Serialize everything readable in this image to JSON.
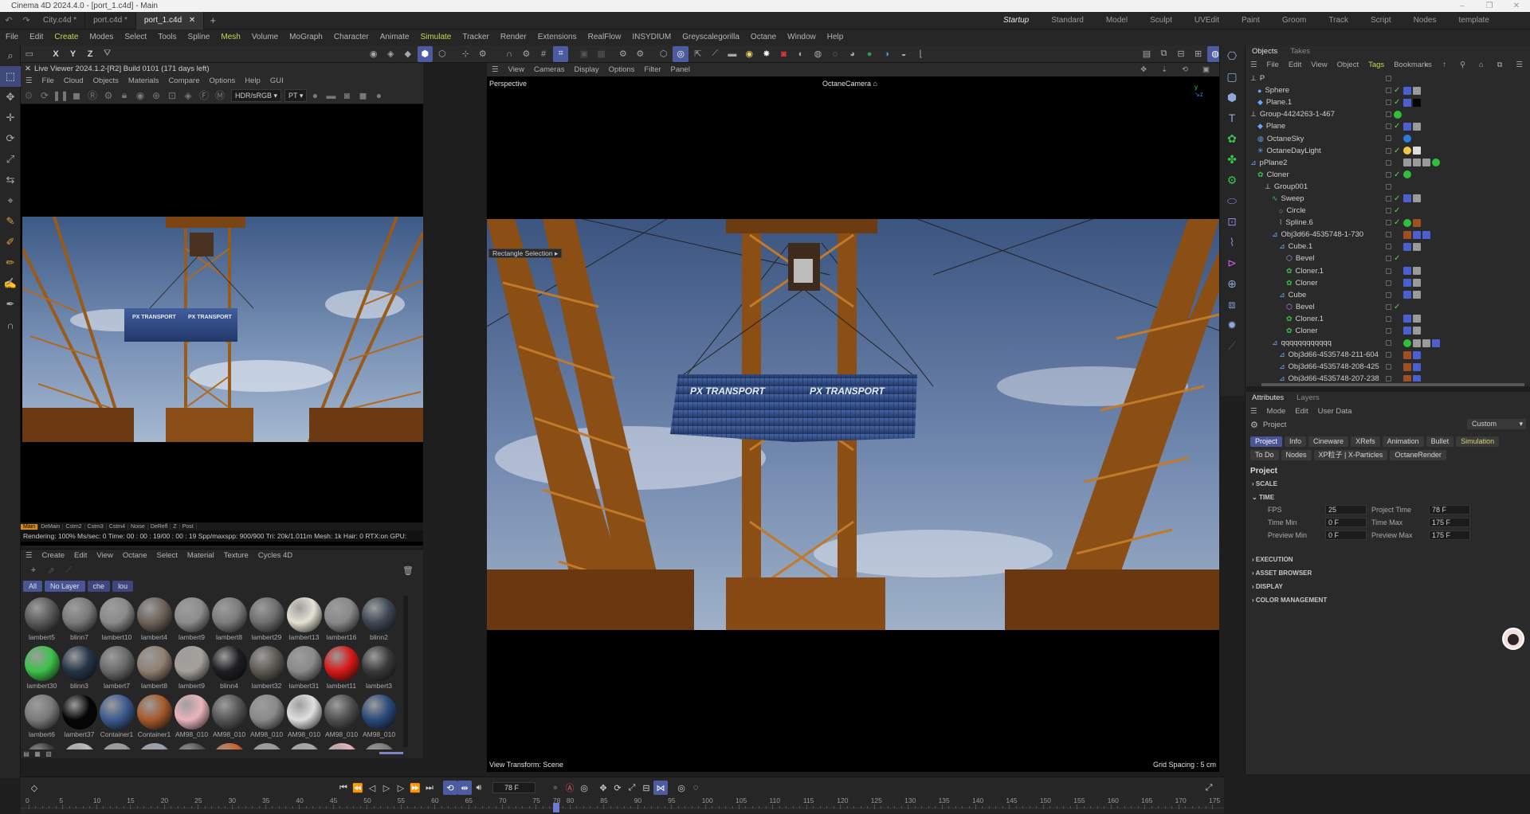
{
  "title": "Cinema 4D 2024.4.0 - [port_1.c4d] - Main",
  "doc_tabs": [
    {
      "label": "City.c4d *"
    },
    {
      "label": "port.c4d *"
    },
    {
      "label": "port_1.c4d"
    }
  ],
  "layouts": [
    {
      "label": "Startup",
      "active": true
    },
    {
      "label": "Standard"
    },
    {
      "label": "Model"
    },
    {
      "label": "Sculpt"
    },
    {
      "label": "UVEdit"
    },
    {
      "label": "Paint"
    },
    {
      "label": "Groom"
    },
    {
      "label": "Track"
    },
    {
      "label": "Script"
    },
    {
      "label": "Nodes"
    },
    {
      "label": "template"
    }
  ],
  "menu": [
    "File",
    "Edit",
    "Create",
    "Modes",
    "Select",
    "Tools",
    "Spline",
    "Mesh",
    "Volume",
    "MoGraph",
    "Character",
    "Animate",
    "Simulate",
    "Tracker",
    "Render",
    "Extensions",
    "RealFlow",
    "INSYDIUM",
    "Greyscalegorilla",
    "Octane",
    "Window",
    "Help"
  ],
  "live_viewer": {
    "title": "Live Viewer 2024.1.2-[R2] Build 0101 (171 days left)",
    "menu": [
      "File",
      "Cloud",
      "Objects",
      "Materials",
      "Compare",
      "Options",
      "Help",
      "GUI"
    ],
    "color_space": "HDR/sRGB",
    "kernel": "PT",
    "passes": [
      "Main",
      "DeMain",
      "Cstm2",
      "Cstm3",
      "Cstm4",
      "Noise",
      "DeRefl",
      "Z",
      "Post"
    ],
    "status": "Rendering: 100%   Ms/sec: 0   Time: 00 : 00 : 19/00 : 00 : 19   Spp/maxspp: 900/900     Tri: 20k/1.011m   Mesh: 1k   Hair: 0   RTX:on     GPU:",
    "container_label_1": "PX TRANSPORT",
    "container_label_2": "PX TRANSPORT"
  },
  "material_manager": {
    "menu": [
      "Create",
      "Edit",
      "View",
      "Octane",
      "Select",
      "Material",
      "Texture",
      "Cycles 4D"
    ],
    "filters": [
      "All",
      "No Layer",
      "che",
      "lou"
    ],
    "materials": [
      {
        "name": "lambert5",
        "color": "#5a5a5a"
      },
      {
        "name": "blinn7",
        "color": "#7a7a7a"
      },
      {
        "name": "lambert10",
        "color": "#8a8a8a"
      },
      {
        "name": "lambert4",
        "color": "#6d6258"
      },
      {
        "name": "lambert9",
        "color": "#8c8c8c"
      },
      {
        "name": "lambert8",
        "color": "#7c7c7c"
      },
      {
        "name": "lambert29",
        "color": "#6e6e6e"
      },
      {
        "name": "lambert13",
        "color": "#e4e1d4"
      },
      {
        "name": "lambert16",
        "color": "#888888"
      },
      {
        "name": "blinn2",
        "color": "#3d4855"
      },
      {
        "name": "lambert30",
        "color": "#3cc24a"
      },
      {
        "name": "blinn3",
        "color": "#243548"
      },
      {
        "name": "lambert7",
        "color": "#6a6a6a"
      },
      {
        "name": "lambert8",
        "color": "#8f8070"
      },
      {
        "name": "lambert9",
        "color": "#a5a09a"
      },
      {
        "name": "blinn4",
        "color": "#1e1e22"
      },
      {
        "name": "lambert32",
        "color": "#5e5a52"
      },
      {
        "name": "lambert31",
        "color": "#8a8a8a"
      },
      {
        "name": "lambert11",
        "color": "#d81818"
      },
      {
        "name": "lambert3",
        "color": "#3a3a3a"
      },
      {
        "name": "lambert6",
        "color": "#7a7a7a"
      },
      {
        "name": "lambert37",
        "color": "#050505"
      },
      {
        "name": "Container1",
        "color": "#3c5a90"
      },
      {
        "name": "Container1",
        "color": "#a55a2c"
      },
      {
        "name": "AM98_010",
        "color": "#e9b5bb"
      },
      {
        "name": "AM98_010",
        "color": "#555555"
      },
      {
        "name": "AM98_010",
        "color": "#8a8a8a"
      },
      {
        "name": "AM98_010",
        "color": "#e0e0e0"
      },
      {
        "name": "AM98_010",
        "color": "#4f4f4f"
      },
      {
        "name": "AM98_010",
        "color": "#294a7a"
      },
      {
        "name": "",
        "color": "#3a3a3a"
      },
      {
        "name": "",
        "color": "#bdbdbd"
      },
      {
        "name": "",
        "color": "#9a9a9a"
      },
      {
        "name": "",
        "color": "#9aa0b0"
      },
      {
        "name": "",
        "color": "#555555"
      },
      {
        "name": "",
        "color": "#d25f2a"
      },
      {
        "name": "",
        "color": "#9a9a9a"
      },
      {
        "name": "",
        "color": "#aaaaaa"
      },
      {
        "name": "",
        "color": "#e9b5bb"
      },
      {
        "name": "",
        "color": "#7a7a7a"
      }
    ]
  },
  "viewport": {
    "menu": [
      "View",
      "Cameras",
      "Display",
      "Options",
      "Filter",
      "Panel"
    ],
    "view_name": "Perspective",
    "camera": "OctaneCamera",
    "tooltip": "Rectangle Selection",
    "view_transform": "View Transform: Scene",
    "grid_spacing": "Grid Spacing : 5 cm",
    "container_label_1": "PX TRANSPORT",
    "container_label_2": "PX TRANSPORT"
  },
  "object_manager": {
    "tabs": [
      "Objects",
      "Takes"
    ],
    "menu": [
      "File",
      "Edit",
      "View",
      "Object",
      "Tags",
      "Bookmarks"
    ],
    "items": [
      {
        "name": "P",
        "depth": 0,
        "icon": "null",
        "tags": []
      },
      {
        "name": "Sphere",
        "depth": 1,
        "icon": "sphere",
        "tags": [
          "check",
          "mat-blue",
          "mat-gray"
        ]
      },
      {
        "name": "Plane.1",
        "depth": 1,
        "icon": "plane",
        "tags": [
          "check",
          "mat-blue",
          "mat-black"
        ]
      },
      {
        "name": "Group-4424263-1-467",
        "depth": 0,
        "icon": "null",
        "tags": [
          "green-dot"
        ]
      },
      {
        "name": "Plane",
        "depth": 1,
        "icon": "plane",
        "tags": [
          "check",
          "mat-blue",
          "mat-gray"
        ]
      },
      {
        "name": "OctaneSky",
        "depth": 1,
        "icon": "sky",
        "tags": [
          "",
          "half-blue"
        ]
      },
      {
        "name": "OctaneDayLight",
        "depth": 1,
        "icon": "light",
        "tags": [
          "check",
          "sun",
          "gear"
        ]
      },
      {
        "name": "pPlane2",
        "depth": 0,
        "icon": "poly",
        "tags": [
          "",
          "mat-gray",
          "mat-gray",
          "mat-gray",
          "green-dot"
        ]
      },
      {
        "name": "Cloner",
        "depth": 1,
        "icon": "cloner",
        "tags": [
          "check",
          "green-dot"
        ]
      },
      {
        "name": "Group001",
        "depth": 2,
        "icon": "null",
        "tags": []
      },
      {
        "name": "Sweep",
        "depth": 3,
        "icon": "sweep",
        "tags": [
          "check",
          "mat-blue",
          "mat-gray"
        ]
      },
      {
        "name": "Circle",
        "depth": 4,
        "icon": "circle",
        "tags": [
          "check"
        ]
      },
      {
        "name": "Spline.6",
        "depth": 4,
        "icon": "spline",
        "tags": [
          "check",
          "green-dot",
          "mat-brown"
        ]
      },
      {
        "name": "Obj3d66-4535748-1-730",
        "depth": 3,
        "icon": "poly",
        "tags": [
          "",
          "mat-brown",
          "mat-blue",
          "mat-blue"
        ]
      },
      {
        "name": "Cube.1",
        "depth": 4,
        "icon": "cube",
        "tags": [
          "",
          "mat-blue",
          "mat-gray"
        ]
      },
      {
        "name": "Bevel",
        "depth": 5,
        "icon": "bevel",
        "tags": [
          "check"
        ]
      },
      {
        "name": "Cloner.1",
        "depth": 5,
        "icon": "cloner",
        "tags": [
          "",
          "mat-blue",
          "mat-gray"
        ]
      },
      {
        "name": "Cloner",
        "depth": 5,
        "icon": "cloner",
        "tags": [
          "",
          "mat-blue",
          "mat-gray"
        ]
      },
      {
        "name": "Cube",
        "depth": 4,
        "icon": "cube",
        "tags": [
          "",
          "mat-blue",
          "mat-gray"
        ]
      },
      {
        "name": "Bevel",
        "depth": 5,
        "icon": "bevel",
        "tags": [
          "check"
        ]
      },
      {
        "name": "Cloner.1",
        "depth": 5,
        "icon": "cloner",
        "tags": [
          "",
          "mat-blue",
          "mat-gray"
        ]
      },
      {
        "name": "Cloner",
        "depth": 5,
        "icon": "cloner",
        "tags": [
          "",
          "mat-blue",
          "mat-gray"
        ]
      },
      {
        "name": "qqqqqqqqqqqq",
        "depth": 3,
        "icon": "poly",
        "tags": [
          "",
          "green-dot",
          "mat-gray",
          "mat-gray",
          "mat-blue"
        ]
      },
      {
        "name": "Obj3d66-4535748-211-604",
        "depth": 4,
        "icon": "poly",
        "tags": [
          "",
          "mat-brown",
          "mat-blue"
        ]
      },
      {
        "name": "Obj3d66-4535748-208-425",
        "depth": 4,
        "icon": "poly",
        "tags": [
          "",
          "mat-brown",
          "mat-blue"
        ]
      },
      {
        "name": "Obj3d66-4535748-207-238",
        "depth": 4,
        "icon": "poly",
        "tags": [
          "",
          "mat-brown",
          "mat-blue"
        ]
      }
    ]
  },
  "attributes": {
    "tabs": [
      "Attributes",
      "Layers"
    ],
    "menu": [
      "Mode",
      "Edit",
      "User Data"
    ],
    "context": "Project",
    "preset": "Custom",
    "page_tabs_row1": [
      "Project",
      "Info",
      "Cineware",
      "XRefs",
      "Animation",
      "Bullet",
      "Simulation"
    ],
    "page_tabs_row2": [
      "To Do",
      "Nodes",
      "XP粒子 | X-Particles",
      "OctaneRender"
    ],
    "heading": "Project",
    "sections": [
      "SCALE",
      "TIME",
      "EXECUTION",
      "ASSET BROWSER",
      "DISPLAY",
      "COLOR MANAGEMENT"
    ],
    "time": {
      "fps_label": "FPS",
      "fps": "25",
      "project_time_label": "Project Time",
      "project_time": "78 F",
      "time_min_label": "Time Min",
      "time_min": "0 F",
      "time_max_label": "Time Max",
      "time_max": "175 F",
      "preview_min_label": "Preview Min",
      "preview_min": "0 F",
      "preview_max_label": "Preview Max",
      "preview_max": "175 F"
    }
  },
  "timeline": {
    "current_frame": "78 F",
    "ticks": [
      "0",
      "5",
      "10",
      "15",
      "20",
      "25",
      "30",
      "35",
      "40",
      "45",
      "50",
      "55",
      "60",
      "65",
      "70",
      "75",
      "78",
      "80",
      "85",
      "90",
      "95",
      "100",
      "105",
      "110",
      "115",
      "120",
      "125",
      "130",
      "135",
      "140",
      "145",
      "150",
      "155",
      "160",
      "165",
      "170",
      "175"
    ]
  },
  "colors": {
    "accent": "#4a5596",
    "highlight": "#c7d94b",
    "render_pass_active": "#d58a1a"
  }
}
